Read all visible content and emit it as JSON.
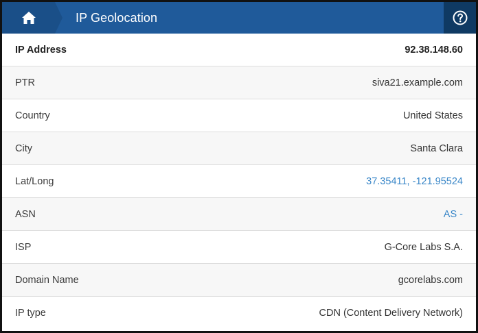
{
  "header": {
    "title": "IP Geolocation",
    "home_icon": "home-icon",
    "help_icon": "help-icon",
    "colors": {
      "bar": "#1f5a9a",
      "home_bg": "#1a4f88",
      "help_bg": "#0f3a63",
      "link": "#3a87c8"
    }
  },
  "details": {
    "ip_address": {
      "label": "IP Address",
      "value": "92.38.148.60"
    },
    "ptr": {
      "label": "PTR",
      "value": "siva21.example.com"
    },
    "country": {
      "label": "Country",
      "value": "United States"
    },
    "city": {
      "label": "City",
      "value": "Santa Clara"
    },
    "latlong": {
      "label": "Lat/Long",
      "value": "37.35411, -121.95524"
    },
    "asn": {
      "label": "ASN",
      "value": "AS -"
    },
    "isp": {
      "label": "ISP",
      "value": "G-Core Labs S.A."
    },
    "domain": {
      "label": "Domain Name",
      "value": "gcorelabs.com"
    },
    "ip_type": {
      "label": "IP type",
      "value": "CDN (Content Delivery Network)"
    }
  }
}
